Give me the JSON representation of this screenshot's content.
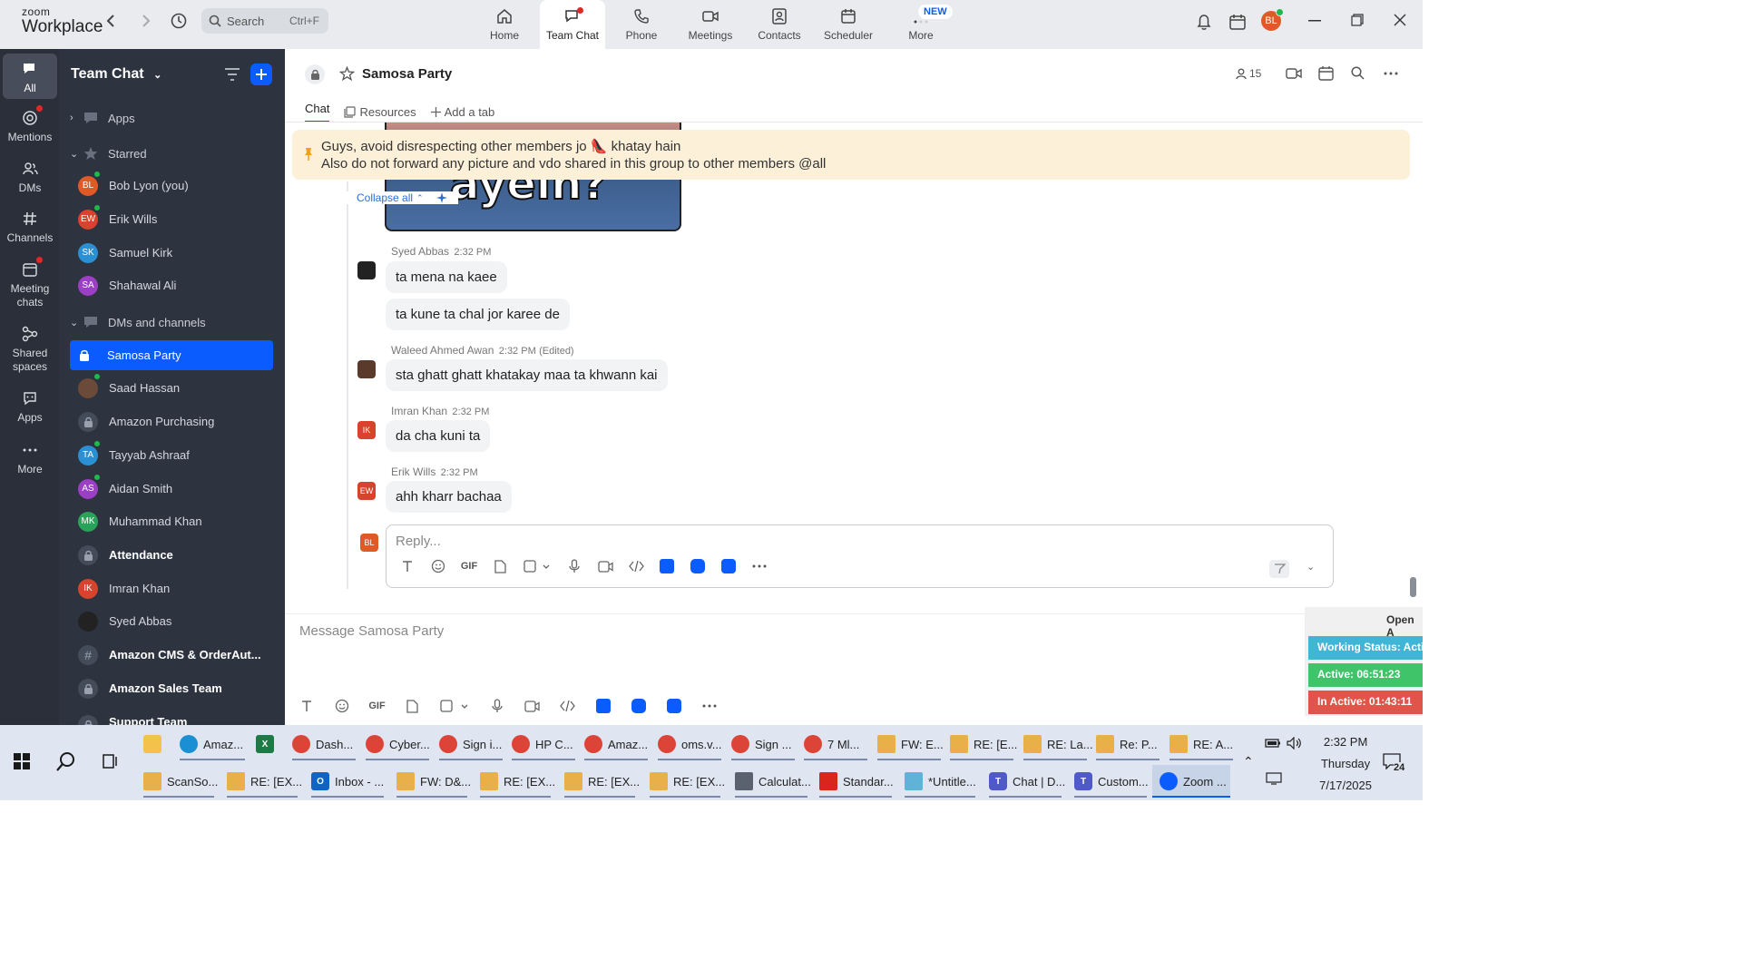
{
  "brand": {
    "line1": "zoom",
    "line2": "Workplace"
  },
  "search": {
    "label": "Search",
    "shortcut": "Ctrl+F"
  },
  "nav_tabs": [
    {
      "label": "Home",
      "icon": "home-icon"
    },
    {
      "label": "Team Chat",
      "icon": "chat-icon"
    },
    {
      "label": "Phone",
      "icon": "phone-icon"
    },
    {
      "label": "Meetings",
      "icon": "video-icon"
    },
    {
      "label": "Contacts",
      "icon": "contacts-icon"
    },
    {
      "label": "Scheduler",
      "icon": "calendar-icon"
    },
    {
      "label": "More",
      "icon": "more-icon"
    }
  ],
  "new_badge": "NEW",
  "user_avatar": {
    "initials": "BL",
    "color": "#e05a28"
  },
  "rail": [
    {
      "label": "All"
    },
    {
      "label": "Mentions"
    },
    {
      "label": "DMs"
    },
    {
      "label": "Channels"
    },
    {
      "label": "Meeting chats"
    },
    {
      "label": "Shared spaces"
    },
    {
      "label": "Apps"
    },
    {
      "label": "More"
    }
  ],
  "sidebar": {
    "title": "Team Chat",
    "apps_label": "Apps",
    "starred_label": "Starred",
    "dms_label": "DMs and channels",
    "starred": [
      {
        "name": "Bob Lyon (you)",
        "initials": "BL",
        "color": "#e05a28"
      },
      {
        "name": "Erik Wills",
        "initials": "EW",
        "color": "#d8432e"
      },
      {
        "name": "Samuel Kirk",
        "initials": "SK",
        "color": "#2b8fd4"
      },
      {
        "name": "Shahawal Ali",
        "initials": "SA",
        "color": "#9b3fc4"
      }
    ],
    "channels": [
      {
        "name": "Samosa Party",
        "type": "lock"
      },
      {
        "name": "Saad Hassan",
        "initials": "SH",
        "color": "#6b4a3a"
      },
      {
        "name": "Amazon Purchasing",
        "type": "lock"
      },
      {
        "name": "Tayyab Ashraaf",
        "initials": "TA",
        "color": "#2b8fd4"
      },
      {
        "name": "Aidan Smith",
        "initials": "AS",
        "color": "#9b3fc4"
      },
      {
        "name": "Muhammad Khan",
        "initials": "MK",
        "color": "#2aa35a"
      },
      {
        "name": "Attendance",
        "type": "lock"
      },
      {
        "name": "Imran Khan",
        "initials": "IK",
        "color": "#d8432e"
      },
      {
        "name": "Syed Abbas",
        "initials": "SA",
        "color": "#333333"
      },
      {
        "name": "Amazon CMS & OrderAut...",
        "type": "hash"
      },
      {
        "name": "Amazon Sales Team",
        "type": "lock"
      },
      {
        "name": "Support Team",
        "type": "lock"
      }
    ]
  },
  "channel": {
    "title": "Samosa Party",
    "member_count": "15",
    "tabs": [
      "Chat",
      "Resources",
      "Add a tab"
    ]
  },
  "pinned": {
    "line1": "Guys, avoid disrespecting other members jo 👠 khatay hain",
    "line2": "Also do not forward any picture and vdo shared in this group to other members @all"
  },
  "image_caption": "ayein?",
  "collapse_label": "Collapse all",
  "messages": [
    {
      "sender": "Syed Abbas",
      "time": "2:32 PM",
      "edited": "",
      "initials": "SA",
      "color": "#222222",
      "texts": [
        "ta mena  na kaee",
        "ta kune ta chal jor karee de"
      ]
    },
    {
      "sender": "Waleed Ahmed Awan",
      "time": "2:32 PM",
      "edited": "(Edited)",
      "initials": "WA",
      "color": "#5a3a2a",
      "texts": [
        "sta ghatt ghatt khatakay maa ta khwann kai"
      ]
    },
    {
      "sender": "Imran Khan",
      "time": "2:32 PM",
      "edited": "",
      "initials": "IK",
      "color": "#d8432e",
      "texts": [
        "da cha kuni ta"
      ]
    },
    {
      "sender": "Erik Wills",
      "time": "2:32 PM",
      "edited": "",
      "initials": "EW",
      "color": "#d8432e",
      "texts": [
        "ahh kharr bachaa"
      ]
    }
  ],
  "reply_placeholder": "Reply...",
  "reply_avatar": {
    "initials": "BL",
    "color": "#e05a28"
  },
  "message_placeholder": "Message Samosa Party",
  "gif_label": "GIF",
  "status_panel": {
    "header": "Open A",
    "working": "Working Status: Acti",
    "active": "Active: 06:51:23",
    "inactive": "In Active: 01:43:11",
    "colors": {
      "working": "#3fb6d6",
      "active": "#3fc46a",
      "inactive": "#e0554a"
    }
  },
  "taskbar": {
    "row1": [
      "Amaz...",
      "Dash...",
      "Cyber...",
      "Sign i...",
      "HP C...",
      "Amaz...",
      "oms.v...",
      "Sign ...",
      "7 Ml...",
      "FW: E...",
      "RE: [E...",
      "RE: La...",
      "Re: P...",
      "RE: A..."
    ],
    "row2": [
      "ScanSo...",
      "RE: [EX...",
      "Inbox - ...",
      "FW: D&...",
      "RE: [EX...",
      "RE: [EX...",
      "RE: [EX...",
      "Calculat...",
      "Standar...",
      "*Untitle...",
      "Chat | D...",
      "Custom...",
      "Zoom ..."
    ],
    "time": "2:32 PM",
    "day": "Thursday",
    "date": "7/17/2025",
    "notif_count": "24"
  }
}
